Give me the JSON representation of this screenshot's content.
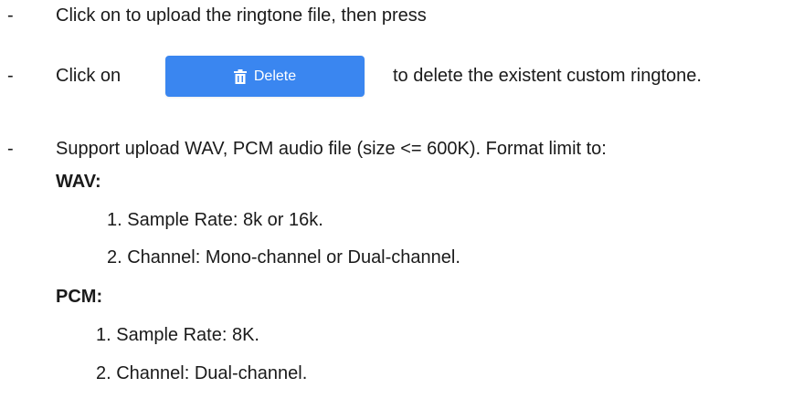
{
  "doc": {
    "bullets": [
      {
        "dash": "-",
        "text": "Click on to upload the ringtone file, then press"
      },
      {
        "dash": "-",
        "text_before": "Click  on",
        "button_label": "Delete",
        "text_after": "to delete the existent custom ringtone."
      },
      {
        "dash": "-",
        "text": "Support upload WAV, PCM audio file (size <= 600K). Format limit to:"
      }
    ],
    "wav": {
      "heading": "WAV:",
      "items": [
        "1. Sample Rate: 8k or 16k.",
        "2. Channel: Mono-channel or Dual-channel."
      ]
    },
    "pcm": {
      "heading": "PCM:",
      "items": [
        "1. Sample Rate: 8K.",
        "2. Channel: Dual-channel."
      ]
    }
  },
  "colors": {
    "button_bg": "#3a86f0",
    "button_text": "#ffffff",
    "body_text": "#1a1a1a"
  },
  "icons": {
    "delete_button_icon": "trash-icon"
  }
}
